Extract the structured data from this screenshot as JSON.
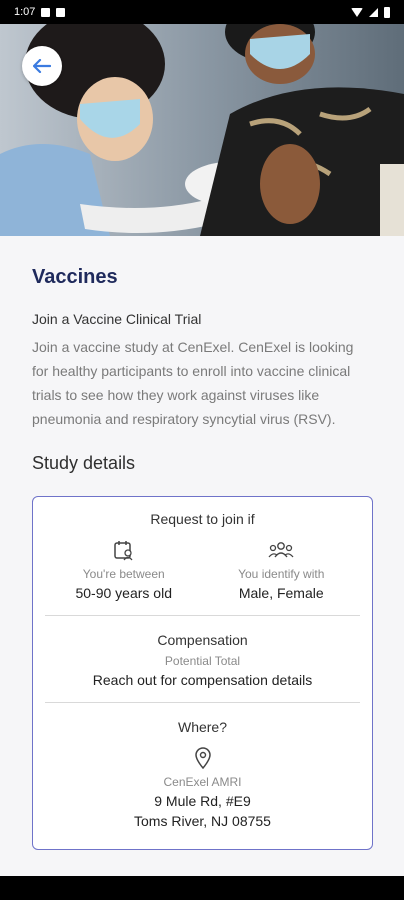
{
  "status": {
    "time": "1:07"
  },
  "hero": {
    "image_desc": "vaccination-photo"
  },
  "header": {
    "title": "Vaccines"
  },
  "intro": {
    "subtitle": "Join a Vaccine Clinical Trial",
    "description": "Join a vaccine study at CenExel. CenExel is looking for healthy participants to enroll into vaccine clinical trials to see how they work against viruses like pneumonia and respiratory syncytial virus (RSV)."
  },
  "details": {
    "section_title": "Study details",
    "request": {
      "heading": "Request to join if",
      "age_label": "You're between",
      "age_value": "50-90 years old",
      "gender_label": "You identify with",
      "gender_value": "Male, Female"
    },
    "compensation": {
      "heading": "Compensation",
      "label": "Potential Total",
      "value": "Reach out for compensation details"
    },
    "where": {
      "heading": "Where?",
      "site": "CenExel AMRI",
      "address1": "9 Mule Rd, #E9",
      "address2": "Toms River, NJ 08755"
    }
  },
  "colors": {
    "title": "#1f2a5c",
    "accent_border": "#6f73c9",
    "back_arrow": "#3b7be0"
  }
}
